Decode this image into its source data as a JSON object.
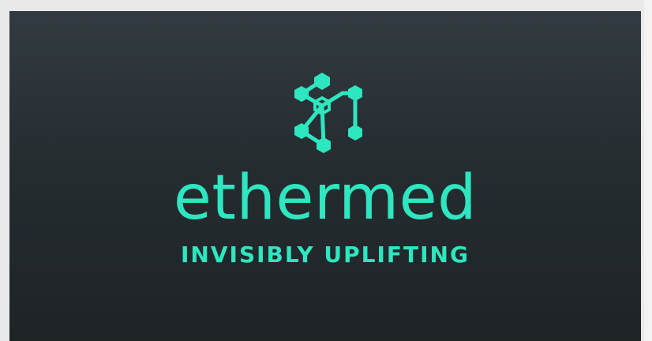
{
  "brand": {
    "name": "ethermed",
    "tagline": "INVISIBLY UPLIFTING",
    "accent_color": "#2ee6bf",
    "background_top": "#323b41",
    "background_bottom": "#1e2326",
    "logo_icon": "molecule-network-icon"
  }
}
